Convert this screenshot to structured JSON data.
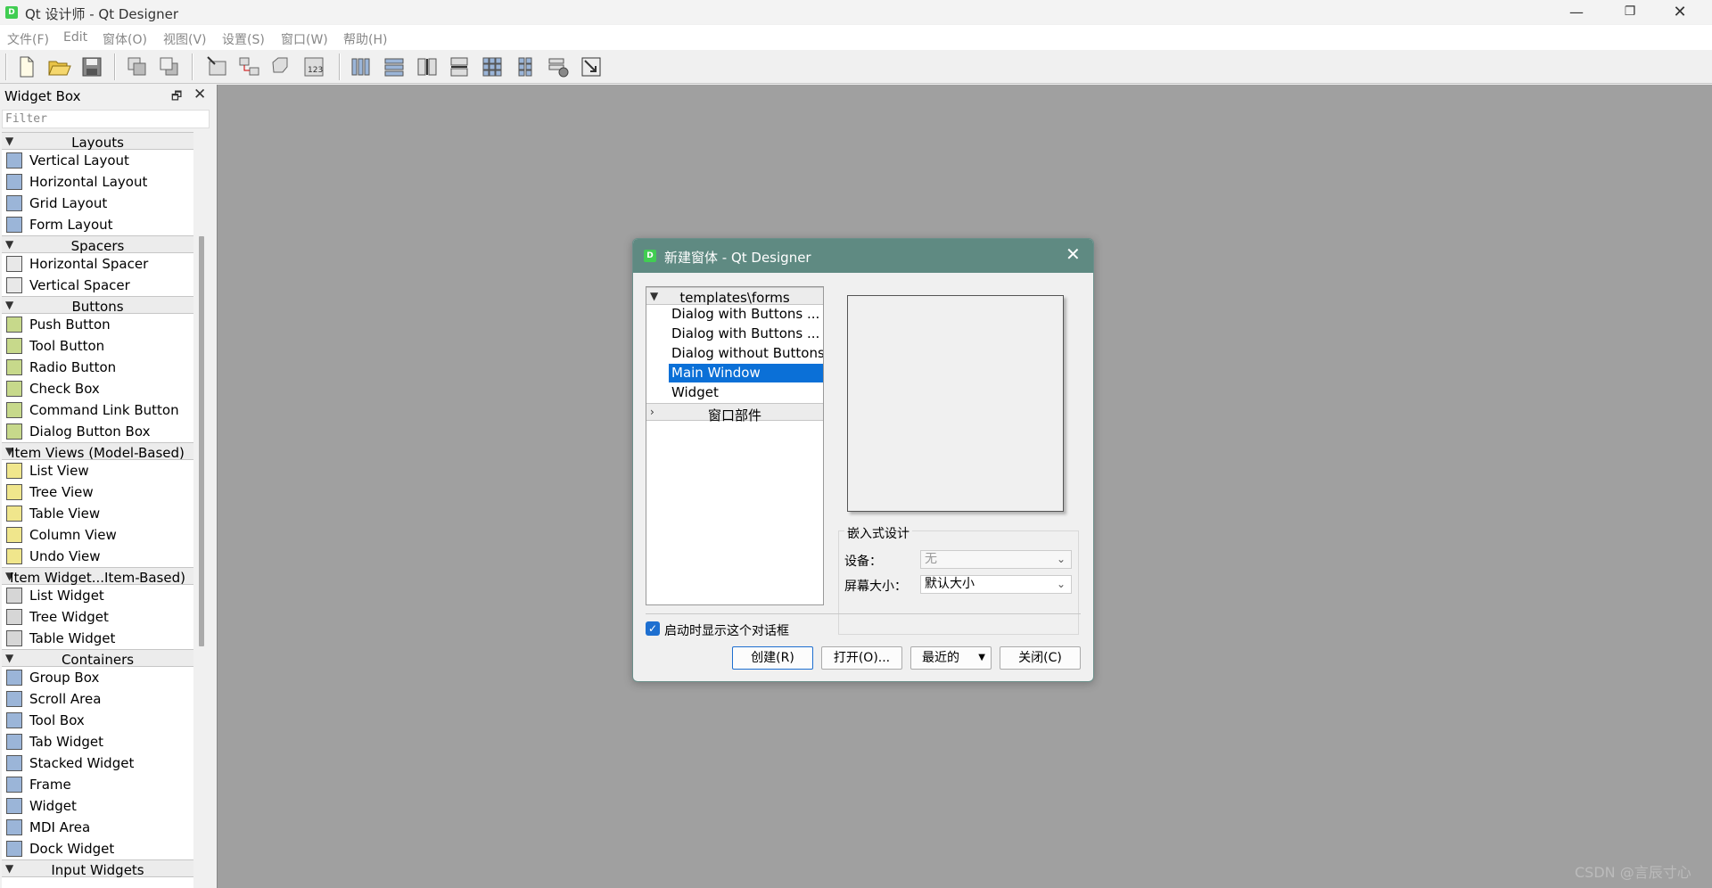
{
  "app": {
    "title": "Qt 设计师 - Qt Designer",
    "icon_letter": "D",
    "window_buttons": {
      "minimize": "—",
      "maximize": "❐",
      "close": "✕"
    }
  },
  "menubar": {
    "items": [
      "文件(F)",
      "Edit",
      "窗体(O)",
      "视图(V)",
      "设置(S)",
      "窗口(W)",
      "帮助(H)"
    ]
  },
  "widget_box": {
    "title": "Widget Box",
    "float_glyph": "🗗",
    "close_glyph": "✕",
    "filter_placeholder": "Filter",
    "categories": [
      {
        "label": "Layouts",
        "items": [
          "Vertical Layout",
          "Horizontal Layout",
          "Grid Layout",
          "Form Layout"
        ]
      },
      {
        "label": "Spacers",
        "items": [
          "Horizontal Spacer",
          "Vertical Spacer"
        ]
      },
      {
        "label": "Buttons",
        "items": [
          "Push Button",
          "Tool Button",
          "Radio Button",
          "Check Box",
          "Command Link Button",
          "Dialog Button Box"
        ]
      },
      {
        "label": "Item Views (Model-Based)",
        "items": [
          "List View",
          "Tree View",
          "Table View",
          "Column View",
          "Undo View"
        ]
      },
      {
        "label": "Item Widget...Item-Based)",
        "items": [
          "List Widget",
          "Tree Widget",
          "Table Widget"
        ]
      },
      {
        "label": "Containers",
        "items": [
          "Group Box",
          "Scroll Area",
          "Tool Box",
          "Tab Widget",
          "Stacked Widget",
          "Frame",
          "Widget",
          "MDI Area",
          "Dock Widget"
        ]
      },
      {
        "label": "Input Widgets",
        "items": []
      }
    ]
  },
  "dialog": {
    "title": "新建窗体 - Qt Designer",
    "icon_letter": "D",
    "close_glyph": "✕",
    "tree": {
      "group1": "templates\\forms",
      "items": [
        "Dialog with Buttons ...",
        "Dialog with Buttons ...",
        "Dialog without Buttons",
        "Main Window",
        "Widget"
      ],
      "selected_index": 3,
      "group2": "窗口部件"
    },
    "embedded_design": {
      "title": "嵌入式设计",
      "device_label": "设备：",
      "device_value": "无",
      "screen_label": "屏幕大小：",
      "screen_value": "默认大小"
    },
    "show_on_startup": {
      "label": "启动时显示这个对话框",
      "checked": true
    },
    "buttons": {
      "create": "创建(R)",
      "open": "打开(O)...",
      "recent": "最近的",
      "close": "关闭(C)"
    }
  },
  "watermark": "CSDN @言辰寸心",
  "colors": {
    "accent": "#0b70d7",
    "dialog_title": "#5f8a82",
    "mdi_bg": "#a0a0a0",
    "qt_green": "#41cd52"
  }
}
